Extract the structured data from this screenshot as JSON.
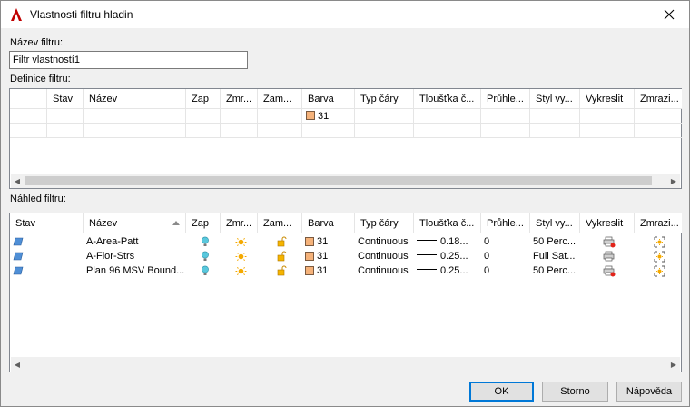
{
  "window": {
    "title": "Vlastnosti filtru hladin",
    "accent": "#c00000"
  },
  "filter_name": {
    "label": "Název filtru:",
    "value": "Filtr vlastností1"
  },
  "definition": {
    "label": "Definice filtru:",
    "columns": [
      "Stav",
      "Název",
      "Zap",
      "Zmr...",
      "Zam...",
      "Barva",
      "Typ čáry",
      "Tloušťka č...",
      "Průhle...",
      "Styl vy...",
      "Vykreslit",
      "Zmrazi..."
    ],
    "row": {
      "color": "31",
      "color_hex": "#f5b27a"
    }
  },
  "preview": {
    "label": "Náhled filtru:",
    "columns": [
      "Stav",
      "Název",
      "Zap",
      "Zmr...",
      "Zam...",
      "Barva",
      "Typ čáry",
      "Tloušťka č...",
      "Průhle...",
      "Styl vy...",
      "Vykreslit",
      "Zmrazi..."
    ],
    "rows": [
      {
        "name": "A-Area-Patt",
        "color": "31",
        "linetype": "Continuous",
        "lineweight": "0.18...",
        "transparency": "0",
        "plotstyle": "50 Perc...",
        "plot": "no-plot"
      },
      {
        "name": "A-Flor-Strs",
        "color": "31",
        "linetype": "Continuous",
        "lineweight": "0.25...",
        "transparency": "0",
        "plotstyle": "Full Sat...",
        "plot": "plot"
      },
      {
        "name": "Plan 96 MSV Bound...",
        "color": "31",
        "linetype": "Continuous",
        "lineweight": "0.25...",
        "transparency": "0",
        "plotstyle": "50 Perc...",
        "plot": "no-plot"
      }
    ]
  },
  "buttons": {
    "ok": "OK",
    "cancel": "Storno",
    "help": "Nápověda"
  },
  "icons": {
    "app": "autocad-a-icon",
    "layer": "layer-state-icon",
    "on": "lightbulb-on-icon",
    "thaw": "sun-thaw-icon",
    "lock": "lock-open-icon",
    "plot": "printer-icon",
    "vp_freeze": "viewport-freeze-icon"
  }
}
